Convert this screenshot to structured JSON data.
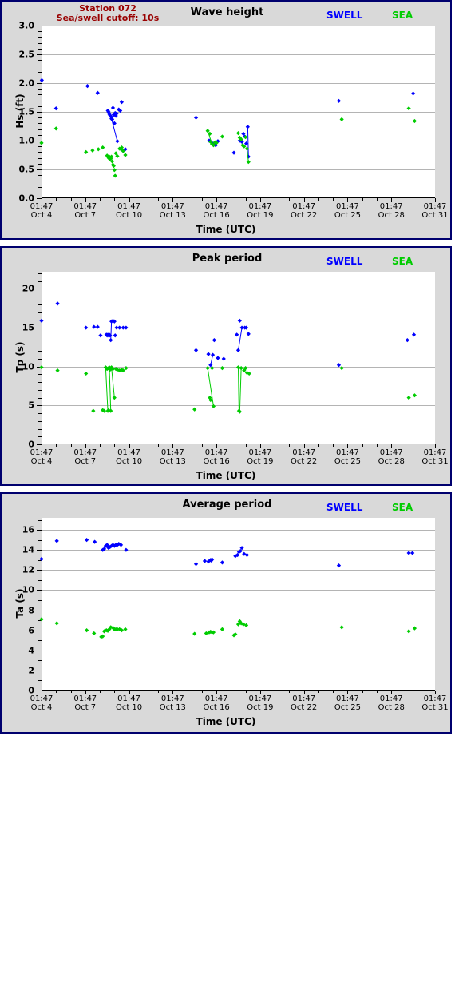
{
  "station": {
    "name": "Station 072",
    "cutoff": "Sea/swell cutoff: 10s"
  },
  "legend": {
    "swell_label": "SWELL",
    "sea_label": "SEA",
    "swell_color": "#0000ff",
    "sea_color": "#00cc00"
  },
  "colors": {
    "panel_background": "#d9d9d9",
    "panel_border": "#00006e",
    "plot_background": "#ffffff",
    "grid": "#b4b4b4",
    "axis": "#000000",
    "station_text": "#990000",
    "page_background": "#ffffff"
  },
  "x_axis": {
    "label": "Time (UTC)",
    "tick_times": [
      "01:47",
      "01:47",
      "01:47",
      "01:47",
      "01:47",
      "01:47",
      "01:47",
      "01:47",
      "01:47",
      "01:47"
    ],
    "tick_dates": [
      "Oct 4",
      "Oct 7",
      "Oct 10",
      "Oct 13",
      "Oct 16",
      "Oct 19",
      "Oct 22",
      "Oct 25",
      "Oct 28",
      "Oct 31"
    ],
    "tick_values": [
      4,
      7,
      10,
      13,
      16,
      19,
      22,
      25,
      28,
      31
    ],
    "minor_tick_interval_days": 1,
    "range": [
      4,
      31
    ]
  },
  "chart_data": [
    {
      "type": "scatter",
      "title": "Wave height",
      "xlabel": "Time (UTC)",
      "ylabel": "Hs (ft)",
      "ylim": [
        0.0,
        3.0
      ],
      "yticks": [
        0.0,
        0.5,
        1.0,
        1.5,
        2.0,
        2.5,
        3.0
      ],
      "ytick_labels": [
        "0.0",
        "0.5",
        "1.0",
        "1.5",
        "2.0",
        "2.5",
        "3.0"
      ],
      "y_minor_interval": 0.1,
      "grid": true,
      "legend_position": "top-right",
      "series": [
        {
          "name": "SWELL",
          "color": "#0000ff",
          "x": [
            4.02,
            5.0,
            7.15,
            7.85,
            8.55,
            8.6,
            8.65,
            8.7,
            8.75,
            8.8,
            8.85,
            8.9,
            8.95,
            9.0,
            9.05,
            9.1,
            9.15,
            9.2,
            9.3,
            9.4,
            9.5,
            9.6,
            9.75,
            14.6,
            15.5,
            15.65,
            15.75,
            15.85,
            15.95,
            16.1,
            17.2,
            17.6,
            17.75,
            17.85,
            17.95,
            18.05,
            18.15,
            18.2,
            24.4,
            29.5
          ],
          "y": [
            2.05,
            1.56,
            1.95,
            1.83,
            1.52,
            1.5,
            1.46,
            1.44,
            1.42,
            1.38,
            1.37,
            1.57,
            1.45,
            1.3,
            1.48,
            1.43,
            1.47,
            0.99,
            1.54,
            1.52,
            1.67,
            0.82,
            0.85,
            1.4,
            1.0,
            0.97,
            0.94,
            0.95,
            0.92,
            0.99,
            0.79,
            1.0,
            0.98,
            1.12,
            1.07,
            0.95,
            1.24,
            0.72,
            1.69,
            1.82
          ],
          "connect_segments": [
            [
              17,
              9
            ],
            [
              37,
              36
            ]
          ]
        },
        {
          "name": "SEA",
          "color": "#00cc00",
          "x": [
            4.0,
            5.0,
            7.05,
            7.5,
            7.9,
            8.2,
            8.5,
            8.6,
            8.65,
            8.7,
            8.75,
            8.8,
            8.85,
            8.9,
            8.95,
            9.0,
            9.05,
            9.1,
            9.2,
            9.35,
            9.45,
            9.5,
            9.6,
            9.75,
            15.4,
            15.55,
            15.6,
            15.7,
            15.8,
            15.9,
            16.0,
            16.4,
            17.5,
            17.6,
            17.7,
            17.8,
            17.9,
            18.0,
            18.1,
            18.2,
            24.6,
            29.2,
            29.6
          ],
          "y": [
            0.96,
            1.21,
            0.8,
            0.83,
            0.85,
            0.88,
            0.74,
            0.7,
            0.72,
            0.68,
            0.69,
            0.72,
            0.64,
            0.58,
            0.56,
            0.49,
            0.39,
            0.78,
            0.73,
            0.86,
            0.85,
            0.88,
            0.82,
            0.75,
            1.17,
            1.12,
            0.98,
            0.94,
            0.92,
            0.97,
            0.96,
            1.07,
            1.13,
            1.05,
            1.02,
            0.92,
            0.9,
            1.06,
            0.86,
            0.63,
            1.37,
            1.56,
            1.34
          ],
          "connect_segments": [
            [
              24,
              27
            ],
            [
              39,
              38
            ]
          ]
        }
      ]
    },
    {
      "type": "scatter",
      "title": "Peak period",
      "xlabel": "Time (UTC)",
      "ylabel": "Tp (s)",
      "ylim": [
        0,
        22.2
      ],
      "yticks": [
        0,
        5,
        10,
        15,
        20
      ],
      "ytick_labels": [
        "0",
        "5",
        "10",
        "15",
        "20"
      ],
      "y_minor_interval": 1,
      "grid": true,
      "legend_position": "top-right",
      "series": [
        {
          "name": "SWELL",
          "color": "#0000ff",
          "x": [
            4.0,
            5.1,
            7.05,
            7.6,
            7.85,
            8.05,
            8.45,
            8.5,
            8.55,
            8.6,
            8.65,
            8.7,
            8.75,
            8.8,
            8.9,
            9.0,
            9.05,
            9.15,
            9.35,
            9.6,
            9.8,
            14.6,
            15.45,
            15.6,
            15.75,
            15.85,
            16.1,
            16.5,
            17.4,
            17.5,
            17.6,
            17.75,
            17.95,
            18.05,
            18.2,
            24.4,
            29.1,
            29.55
          ],
          "y": [
            15.9,
            18.1,
            15.0,
            15.1,
            15.1,
            14.0,
            14.1,
            14.0,
            14.1,
            14.0,
            14.1,
            14.0,
            13.4,
            15.8,
            15.9,
            15.8,
            14.0,
            15.0,
            15.0,
            15.0,
            15.0,
            12.1,
            11.6,
            10.2,
            11.5,
            13.4,
            11.1,
            11.0,
            14.1,
            12.1,
            15.9,
            15.0,
            15.0,
            15.0,
            14.2,
            10.2,
            13.4,
            14.1
          ],
          "connect_segments": [
            [
              13,
              12
            ],
            [
              24,
              23
            ],
            [
              31,
              29
            ]
          ]
        },
        {
          "name": "SEA",
          "color": "#00cc00",
          "x": [
            4.0,
            5.1,
            7.05,
            7.55,
            8.2,
            8.3,
            8.4,
            8.45,
            8.5,
            8.55,
            8.6,
            8.65,
            8.7,
            8.75,
            8.8,
            8.9,
            9.0,
            9.1,
            9.2,
            9.35,
            9.5,
            9.6,
            9.8,
            14.5,
            15.4,
            15.55,
            15.6,
            15.7,
            15.8,
            16.4,
            17.5,
            17.55,
            17.6,
            17.7,
            17.9,
            18.0,
            18.1,
            18.25,
            24.6,
            29.2,
            29.6
          ],
          "y": [
            9.9,
            9.5,
            9.1,
            4.3,
            4.4,
            4.3,
            9.9,
            9.8,
            9.7,
            4.3,
            4.4,
            9.9,
            9.6,
            4.3,
            9.9,
            9.7,
            6.0,
            9.7,
            9.6,
            9.5,
            9.6,
            9.5,
            9.8,
            4.5,
            9.8,
            6.0,
            5.7,
            9.8,
            4.9,
            9.8,
            9.9,
            4.3,
            4.2,
            9.8,
            9.5,
            9.8,
            9.2,
            9.1,
            9.8,
            6.0,
            6.3
          ],
          "connect_segments": [
            [
              9,
              6
            ],
            [
              13,
              11
            ],
            [
              16,
              14
            ],
            [
              28,
              24
            ],
            [
              31,
              30
            ],
            [
              33,
              32
            ]
          ]
        }
      ]
    },
    {
      "type": "scatter",
      "title": "Average period",
      "xlabel": "Time (UTC)",
      "ylabel": "Ta (s)",
      "ylim": [
        0,
        17.2
      ],
      "yticks": [
        0,
        2,
        4,
        6,
        8,
        10,
        12,
        14,
        16
      ],
      "ytick_labels": [
        "0",
        "2",
        "4",
        "6",
        "8",
        "10",
        "12",
        "14",
        "16"
      ],
      "y_minor_interval": 1,
      "grid": true,
      "legend_position": "top-right",
      "series": [
        {
          "name": "SWELL",
          "color": "#0000ff",
          "x": [
            4.0,
            5.05,
            7.1,
            7.65,
            8.2,
            8.3,
            8.4,
            8.5,
            8.55,
            8.6,
            8.7,
            8.8,
            8.9,
            9.0,
            9.1,
            9.2,
            9.3,
            9.45,
            9.8,
            14.6,
            15.2,
            15.45,
            15.6,
            15.65,
            15.7,
            16.4,
            17.3,
            17.45,
            17.55,
            17.65,
            17.75,
            17.9,
            18.1,
            24.4,
            29.2,
            29.45
          ],
          "y": [
            13.1,
            14.9,
            15.0,
            14.8,
            14.0,
            14.1,
            14.4,
            14.5,
            14.3,
            14.2,
            14.3,
            14.4,
            14.5,
            14.4,
            14.5,
            14.5,
            14.6,
            14.5,
            14.0,
            12.6,
            12.9,
            12.85,
            13.0,
            12.95,
            13.05,
            12.75,
            13.4,
            13.5,
            13.8,
            13.9,
            14.2,
            13.6,
            13.5,
            12.45,
            13.7,
            13.7
          ],
          "connect_segments": []
        },
        {
          "name": "SEA",
          "color": "#00cc00",
          "x": [
            4.0,
            5.05,
            7.1,
            7.6,
            8.1,
            8.2,
            8.3,
            8.45,
            8.55,
            8.65,
            8.75,
            8.9,
            9.0,
            9.1,
            9.2,
            9.35,
            9.5,
            9.75,
            14.5,
            15.3,
            15.5,
            15.6,
            15.7,
            15.8,
            16.4,
            17.2,
            17.3,
            17.5,
            17.6,
            17.7,
            17.85,
            18.05,
            24.6,
            29.2,
            29.6
          ],
          "y": [
            7.1,
            6.7,
            6.0,
            5.7,
            5.35,
            5.4,
            5.9,
            6.0,
            5.95,
            6.1,
            6.3,
            6.25,
            6.1,
            6.1,
            6.1,
            6.1,
            6.0,
            6.1,
            5.65,
            5.7,
            5.8,
            5.85,
            5.8,
            5.8,
            6.1,
            5.5,
            5.6,
            6.6,
            6.9,
            6.7,
            6.6,
            6.5,
            6.3,
            5.9,
            6.2
          ],
          "connect_segments": []
        }
      ]
    }
  ]
}
